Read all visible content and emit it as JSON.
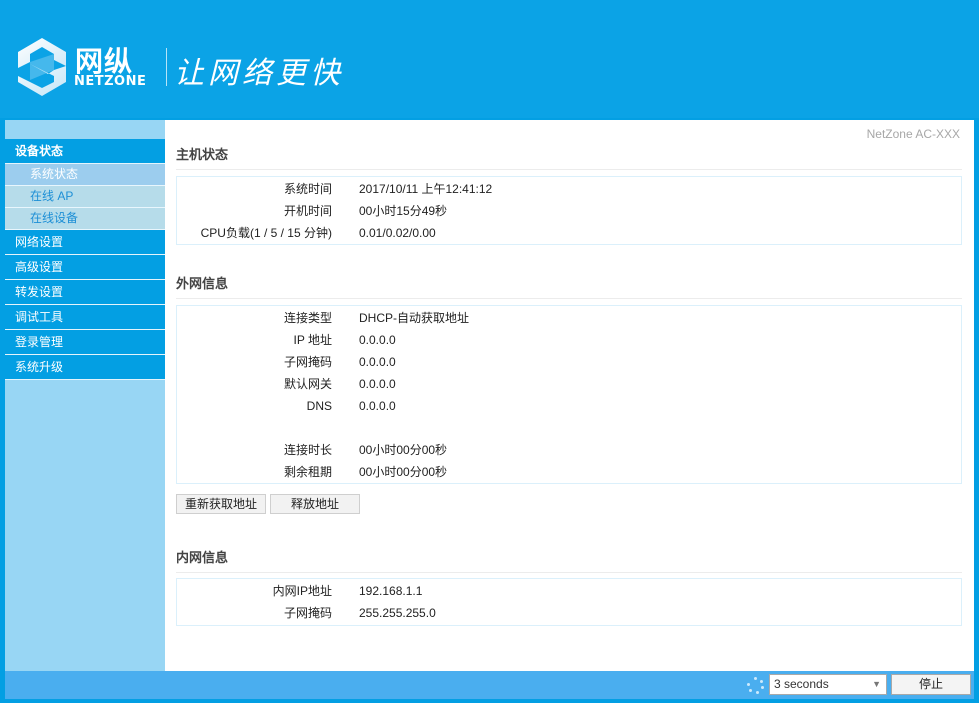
{
  "header": {
    "logo_cn": "网纵",
    "logo_en": "NETZONE",
    "slogan": "让网络更快"
  },
  "sidebar": {
    "items": [
      {
        "label": "设备状态",
        "active": true,
        "children": [
          {
            "label": "系统状态",
            "current": true
          },
          {
            "label": "在线 AP",
            "current": false
          },
          {
            "label": "在线设备",
            "current": false
          }
        ]
      },
      {
        "label": "网络设置"
      },
      {
        "label": "高级设置"
      },
      {
        "label": "转发设置"
      },
      {
        "label": "调试工具"
      },
      {
        "label": "登录管理"
      },
      {
        "label": "系统升级"
      }
    ]
  },
  "content": {
    "model": "NetZone AC-XXX",
    "host_status": {
      "title": "主机状态",
      "rows": [
        {
          "label": "系统时间",
          "value": "2017/10/11 上午12:41:12"
        },
        {
          "label": "开机时间",
          "value": "00小时15分49秒"
        },
        {
          "label": "CPU负载(1 / 5 / 15 分钟)",
          "value": "0.01/0.02/0.00"
        }
      ]
    },
    "wan_info": {
      "title": "外网信息",
      "rows": [
        {
          "label": "连接类型",
          "value": "DHCP-自动获取地址"
        },
        {
          "label": "IP 地址",
          "value": "0.0.0.0"
        },
        {
          "label": "子网掩码",
          "value": "0.0.0.0"
        },
        {
          "label": "默认网关",
          "value": "0.0.0.0"
        },
        {
          "label": "DNS",
          "value": "0.0.0.0"
        },
        {
          "label": "",
          "value": ""
        },
        {
          "label": "连接时长",
          "value": "00小时00分00秒"
        },
        {
          "label": "剩余租期",
          "value": "00小时00分00秒"
        }
      ],
      "renew_button": "重新获取地址",
      "release_button": "释放地址"
    },
    "lan_info": {
      "title": "内网信息",
      "rows": [
        {
          "label": "内网IP地址",
          "value": "192.168.1.1"
        },
        {
          "label": "子网掩码",
          "value": "255.255.255.0"
        }
      ]
    }
  },
  "footer": {
    "refresh_interval": "3 seconds",
    "stop_button": "停止"
  },
  "colors": {
    "brand_blue": "#039fe3",
    "sidebar_bg": "#98d6f4",
    "footer_bg": "#4aaeef"
  }
}
